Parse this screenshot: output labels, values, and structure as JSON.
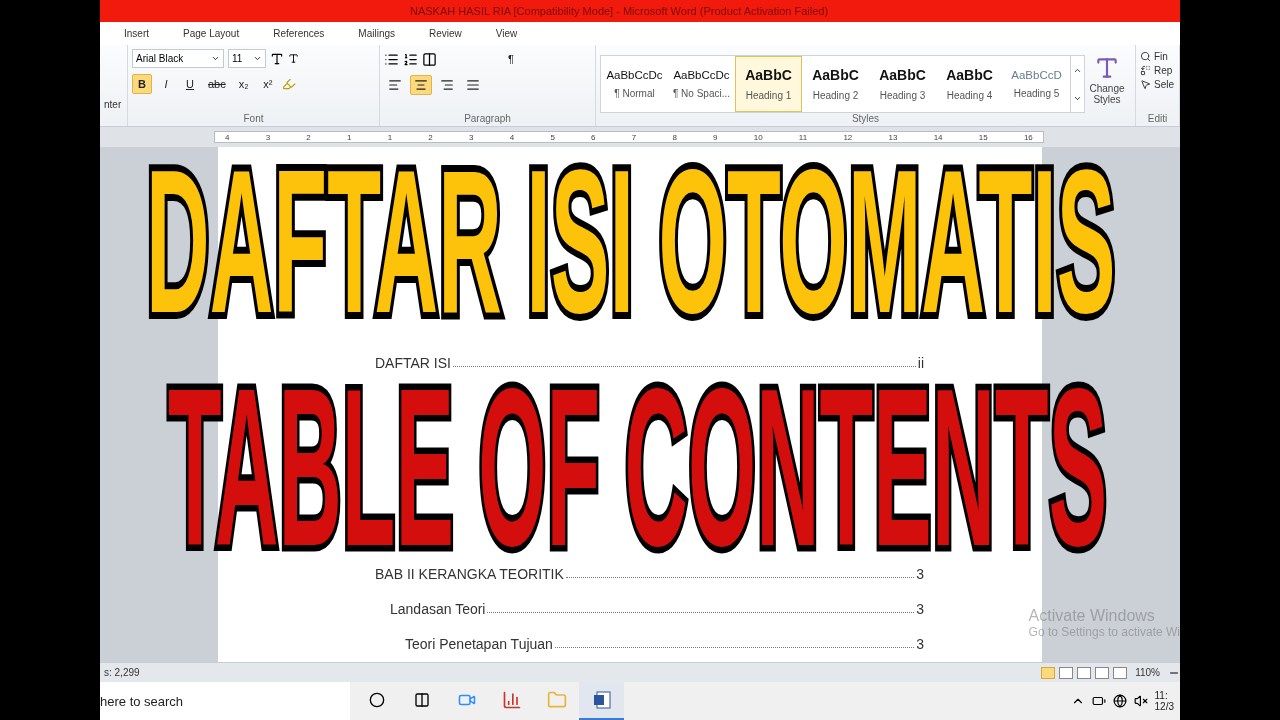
{
  "window": {
    "title": "NASKAH HASIL RIA [Compatibility Mode]  -  Microsoft Word (Product Activation Failed)"
  },
  "tabs": [
    {
      "label": "Insert",
      "selected": false
    },
    {
      "label": "Page Layout",
      "selected": false
    },
    {
      "label": "References",
      "selected": false
    },
    {
      "label": "Mailings",
      "selected": false
    },
    {
      "label": "Review",
      "selected": false
    },
    {
      "label": "View",
      "selected": false
    }
  ],
  "clipboard": {
    "label": "nter"
  },
  "font": {
    "name": "Arial Black",
    "size": "11",
    "group_label": "Font",
    "buttons": [
      {
        "label": "B",
        "selected": true
      },
      {
        "label": "I",
        "selected": false
      },
      {
        "label": "U",
        "selected": false
      },
      {
        "label": "abc",
        "selected": false
      },
      {
        "label": "x₂",
        "selected": false
      },
      {
        "label": "x²",
        "selected": false
      }
    ]
  },
  "paragraph": {
    "group_label": "Paragraph",
    "pilcrow": "¶",
    "align": [
      {
        "selected": false
      },
      {
        "selected": true
      },
      {
        "selected": false
      },
      {
        "selected": false
      }
    ]
  },
  "styles": {
    "group_label": "Styles",
    "items": [
      {
        "preview": "AaBbCcDc",
        "label": "¶ Normal",
        "kind": "plain",
        "selected": false
      },
      {
        "preview": "AaBbCcDc",
        "label": "¶ No Spaci...",
        "kind": "plain",
        "selected": false
      },
      {
        "preview": "AaBbC",
        "label": "Heading 1",
        "kind": "heading",
        "selected": true
      },
      {
        "preview": "AaBbC",
        "label": "Heading 2",
        "kind": "heading",
        "selected": false
      },
      {
        "preview": "AaBbC",
        "label": "Heading 3",
        "kind": "heading",
        "selected": false
      },
      {
        "preview": "AaBbC",
        "label": "Heading 4",
        "kind": "heading",
        "selected": false
      },
      {
        "preview": "AaBbCcD",
        "label": "Heading 5",
        "kind": "faint",
        "selected": false
      }
    ],
    "change_label": "Change Styles"
  },
  "editing": {
    "items": [
      "Fin",
      "Rep",
      "Sele"
    ],
    "group_label": "Editi"
  },
  "ruler": {
    "numbers": [
      "4",
      "3",
      "2",
      "1",
      "1",
      "2",
      "3",
      "4",
      "5",
      "6",
      "7",
      "8",
      "9",
      "10",
      "11",
      "12",
      "13",
      "14",
      "15",
      "16"
    ]
  },
  "toc": [
    {
      "text": "DAFTAR ISI",
      "page": "ii"
    },
    {
      "text": "BAB II KERANGKA TEORITIK",
      "page": "3",
      "children": [
        {
          "text": "Landasan Teori",
          "page": "3",
          "children": [
            {
              "text": "Teori Penetapan Tujuan",
              "page": "3"
            }
          ]
        }
      ]
    }
  ],
  "activation": {
    "title": "Activate Windows",
    "hint": "Go to Settings to activate Wi"
  },
  "status_bar": {
    "words": "s: 2,299",
    "zoom": "110%"
  },
  "taskbar": {
    "search": "here to search",
    "time": "11:",
    "date": "12/3"
  },
  "overlay": {
    "headline": "DAFTAR ISI OTOMATIS",
    "subtitle": "TABLE OF CONTENTS"
  }
}
